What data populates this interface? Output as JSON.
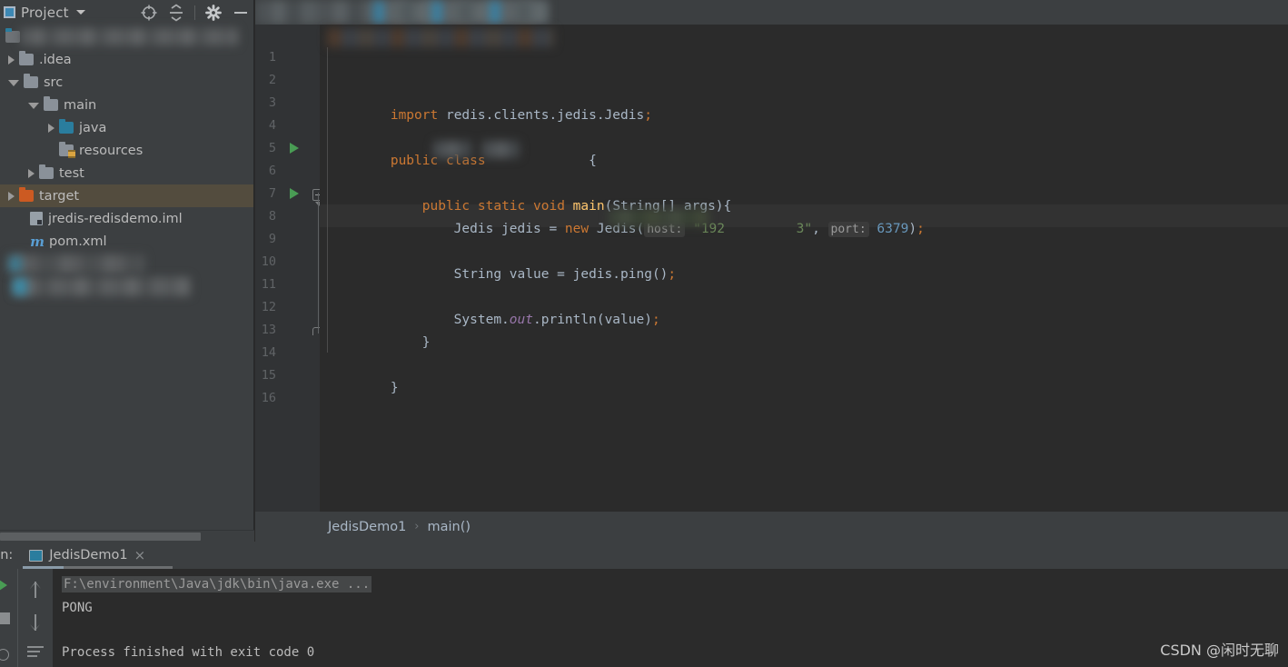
{
  "project_panel": {
    "title": "Project",
    "icons": [
      "project-view-icon",
      "chevron-down-icon",
      "locate-icon",
      "collapse-all-icon",
      "settings-gear-icon",
      "hide-panel-icon"
    ],
    "tree": [
      {
        "label": "",
        "redacted": true,
        "indent": 0,
        "arrow": "none",
        "icon": "module-folder",
        "selected": false
      },
      {
        "label": ".idea",
        "redacted": false,
        "indent": 1,
        "arrow": "closed",
        "icon": "folder",
        "selected": false
      },
      {
        "label": "src",
        "redacted": false,
        "indent": 1,
        "arrow": "open",
        "icon": "folder",
        "selected": false
      },
      {
        "label": "main",
        "redacted": false,
        "indent": 2,
        "arrow": "open",
        "icon": "folder",
        "selected": false
      },
      {
        "label": "java",
        "redacted": false,
        "indent": 3,
        "arrow": "closed",
        "icon": "source-root-folder",
        "selected": false
      },
      {
        "label": "resources",
        "redacted": false,
        "indent": 3,
        "arrow": "none",
        "icon": "resources-folder",
        "selected": false
      },
      {
        "label": "test",
        "redacted": false,
        "indent": 2,
        "arrow": "closed",
        "icon": "folder",
        "selected": false
      },
      {
        "label": "target",
        "redacted": false,
        "indent": 1,
        "arrow": "closed",
        "icon": "excluded-folder",
        "selected": true
      },
      {
        "label": "jredis-redisdemo.iml",
        "redacted": false,
        "indent": 2,
        "arrow": "none",
        "icon": "iml-file",
        "selected": false
      },
      {
        "label": "pom.xml",
        "redacted": false,
        "indent": 2,
        "arrow": "none",
        "icon": "maven-file",
        "selected": false
      },
      {
        "label": "",
        "redacted": true,
        "indent": 1,
        "arrow": "none",
        "icon": "library",
        "selected": false
      },
      {
        "label": "",
        "redacted": true,
        "indent": 1,
        "arrow": "none",
        "icon": "library",
        "selected": false
      }
    ]
  },
  "editor": {
    "tab_bar_redacted": true,
    "line_numbers": [
      "1",
      "2",
      "3",
      "4",
      "5",
      "6",
      "7",
      "8",
      "9",
      "10",
      "11",
      "12",
      "13",
      "14",
      "15",
      "16"
    ],
    "current_line": 9,
    "run_markers_on_lines": [
      5,
      7
    ],
    "fold_marker_line": 7,
    "fold_end_line": 13,
    "lines": [
      {
        "n": 1,
        "redacted": true,
        "text": ""
      },
      {
        "n": 2,
        "text": ""
      },
      {
        "n": 3,
        "tokens": [
          {
            "t": "import",
            "c": "kw"
          },
          {
            "t": " redis.clients.jedis.Jedis",
            "c": "pln"
          },
          {
            "t": ";",
            "c": "semi"
          }
        ]
      },
      {
        "n": 4,
        "text": ""
      },
      {
        "n": 5,
        "tokens": [
          {
            "t": "public",
            "c": "kw"
          },
          {
            "t": " ",
            "c": "pln"
          },
          {
            "t": "class",
            "c": "kw"
          },
          {
            "t": " ",
            "c": "pln"
          },
          {
            "t": "████████",
            "c": "redacted"
          },
          {
            "t": " {",
            "c": "pln"
          }
        ]
      },
      {
        "n": 6,
        "text": ""
      },
      {
        "n": 7,
        "tokens": [
          {
            "t": "    ",
            "c": "pln"
          },
          {
            "t": "public",
            "c": "kw"
          },
          {
            "t": " ",
            "c": "pln"
          },
          {
            "t": "static",
            "c": "kw"
          },
          {
            "t": " ",
            "c": "pln"
          },
          {
            "t": "void",
            "c": "kw"
          },
          {
            "t": " ",
            "c": "pln"
          },
          {
            "t": "main",
            "c": "mth"
          },
          {
            "t": "(String[] args){",
            "c": "pln"
          }
        ]
      },
      {
        "n": 8,
        "tokens": [
          {
            "t": "        Jedis jedis = ",
            "c": "pln"
          },
          {
            "t": "new",
            "c": "kw"
          },
          {
            "t": " Jedis(",
            "c": "pln"
          },
          {
            "t": "host:",
            "c": "hint"
          },
          {
            "t": " \"192",
            "c": "str"
          },
          {
            "t": "██████",
            "c": "redacted"
          },
          {
            "t": "3\"",
            "c": "str"
          },
          {
            "t": ", ",
            "c": "pln"
          },
          {
            "t": "port:",
            "c": "hint"
          },
          {
            "t": " ",
            "c": "pln"
          },
          {
            "t": "6379",
            "c": "num"
          },
          {
            "t": ")",
            "c": "pln"
          },
          {
            "t": ";",
            "c": "semi"
          }
        ]
      },
      {
        "n": 9,
        "text": ""
      },
      {
        "n": 10,
        "tokens": [
          {
            "t": "        String value = jedis.",
            "c": "pln"
          },
          {
            "t": "ping",
            "c": "pln"
          },
          {
            "t": "()",
            "c": "pln"
          },
          {
            "t": ";",
            "c": "semi"
          }
        ]
      },
      {
        "n": 11,
        "text": ""
      },
      {
        "n": 12,
        "tokens": [
          {
            "t": "        System.",
            "c": "pln"
          },
          {
            "t": "out",
            "c": "fld"
          },
          {
            "t": ".println(value)",
            "c": "pln"
          },
          {
            "t": ";",
            "c": "semi"
          }
        ]
      },
      {
        "n": 13,
        "tokens": [
          {
            "t": "    }",
            "c": "pln"
          }
        ]
      },
      {
        "n": 14,
        "text": ""
      },
      {
        "n": 15,
        "tokens": [
          {
            "t": "}",
            "c": "pln"
          }
        ]
      },
      {
        "n": 16,
        "text": ""
      }
    ]
  },
  "breadcrumb": {
    "class": "JedisDemo1",
    "separator": "›",
    "method": "main()"
  },
  "run_panel": {
    "label": "un:",
    "tab_name": "JedisDemo1",
    "tab_icon": "run-configuration-icon",
    "close_icon": "×",
    "toolbar_icons": [
      "rerun-icon",
      "stop-icon",
      "copy-icon",
      "arrow-up-icon",
      "arrow-down-icon",
      "soft-wrap-icon"
    ],
    "console": [
      {
        "text": "F:\\environment\\Java\\jdk\\bin\\java.exe ...",
        "style": "cmd"
      },
      {
        "text": "PONG",
        "style": "out"
      },
      {
        "text": "Process finished with exit code 0",
        "style": "out"
      }
    ]
  },
  "watermark": {
    "text": "CSDN @闲时无聊"
  },
  "colors": {
    "editor_bg": "#2b2b2b",
    "panel_bg": "#3c3f41",
    "gutter_bg": "#313335",
    "selection_bg": "#534c3e",
    "caret_row_bg": "#323232",
    "keyword": "#cc7832",
    "string": "#6a8759",
    "number": "#6897bb",
    "method": "#ffc66d",
    "plain": "#a9b7c6",
    "field": "#9876aa",
    "line_number": "#606366",
    "run_green": "#499c54",
    "source_root": "#2a7d9e",
    "excluded": "#cc5a22"
  }
}
